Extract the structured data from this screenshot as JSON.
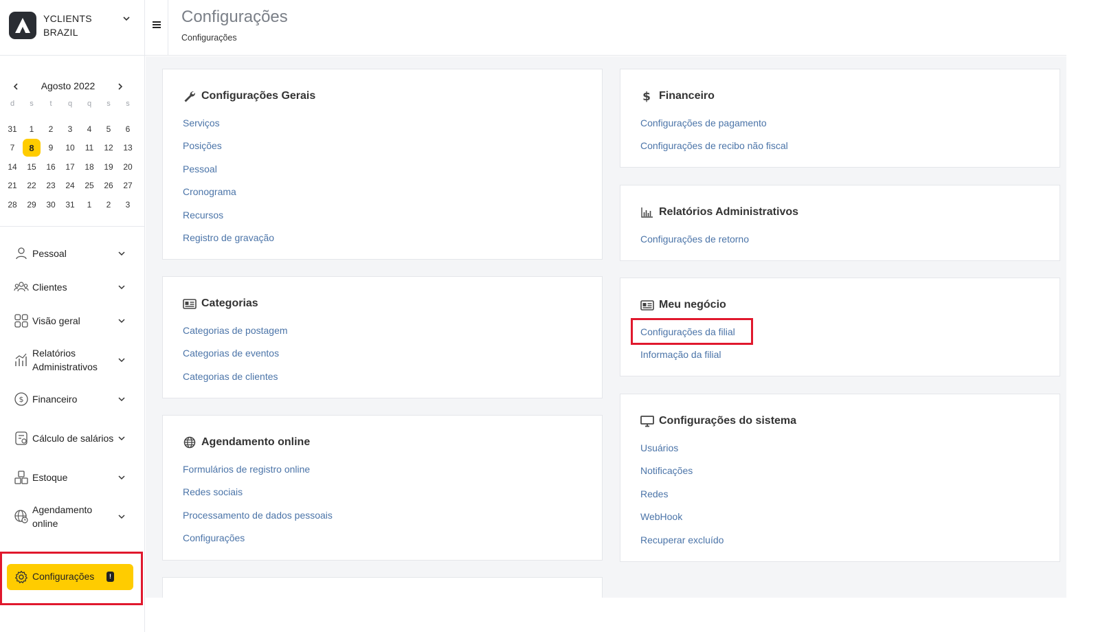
{
  "brand": {
    "name_line1": "YCLIENTS",
    "name_line2": "BRAZIL"
  },
  "calendar": {
    "month_label": "Agosto 2022",
    "weekdays": [
      "d",
      "s",
      "t",
      "q",
      "q",
      "s",
      "s"
    ],
    "days": [
      "31",
      "1",
      "2",
      "3",
      "4",
      "5",
      "6",
      "7",
      "8",
      "9",
      "10",
      "11",
      "12",
      "13",
      "14",
      "15",
      "16",
      "17",
      "18",
      "19",
      "20",
      "21",
      "22",
      "23",
      "24",
      "25",
      "26",
      "27",
      "28",
      "29",
      "30",
      "31",
      "1",
      "2",
      "3"
    ],
    "today": "8"
  },
  "sidebar": {
    "items": [
      {
        "label": "Pessoal",
        "icon": "person-icon"
      },
      {
        "label": "Clientes",
        "icon": "clients-icon"
      },
      {
        "label": "Visão geral",
        "icon": "grid-icon"
      },
      {
        "label": "Relatórios Administrativos",
        "icon": "reports-icon"
      },
      {
        "label": "Financeiro",
        "icon": "dollar-circle-icon"
      },
      {
        "label": "Cálculo de salários",
        "icon": "payroll-icon"
      },
      {
        "label": "Estoque",
        "icon": "boxes-icon"
      },
      {
        "label": "Agendamento online",
        "icon": "globe-clock-icon"
      }
    ],
    "settings_label": "Configurações",
    "settings_badge": "!"
  },
  "header": {
    "title": "Configurações",
    "breadcrumb": "Configurações"
  },
  "cards": {
    "gerais": {
      "title": "Configurações Gerais",
      "links": [
        "Serviços",
        "Posições",
        "Pessoal",
        "Cronograma",
        "Recursos",
        "Registro de gravação"
      ]
    },
    "categorias": {
      "title": "Categorias",
      "links": [
        "Categorias de postagem",
        "Categorias de eventos",
        "Categorias de clientes"
      ]
    },
    "agendamento": {
      "title": "Agendamento online",
      "links": [
        "Formulários de registro online",
        "Redes sociais",
        "Processamento de dados pessoais",
        "Configurações"
      ]
    },
    "financeiro": {
      "title": "Financeiro",
      "links": [
        "Configurações de pagamento",
        "Configurações de recibo não fiscal"
      ]
    },
    "relatorios": {
      "title": "Relatórios Administrativos",
      "links": [
        "Configurações de retorno"
      ]
    },
    "negocio": {
      "title": "Meu negócio",
      "links": [
        "Configurações da filial",
        "Informação da filial"
      ]
    },
    "sistema": {
      "title": "Configurações do sistema",
      "links": [
        "Usuários",
        "Notificações",
        "Redes",
        "WebHook",
        "Recuperar excluído"
      ]
    }
  },
  "colors": {
    "accent": "#ffcc00",
    "link": "#4b74a8",
    "highlight": "#e0182d"
  }
}
